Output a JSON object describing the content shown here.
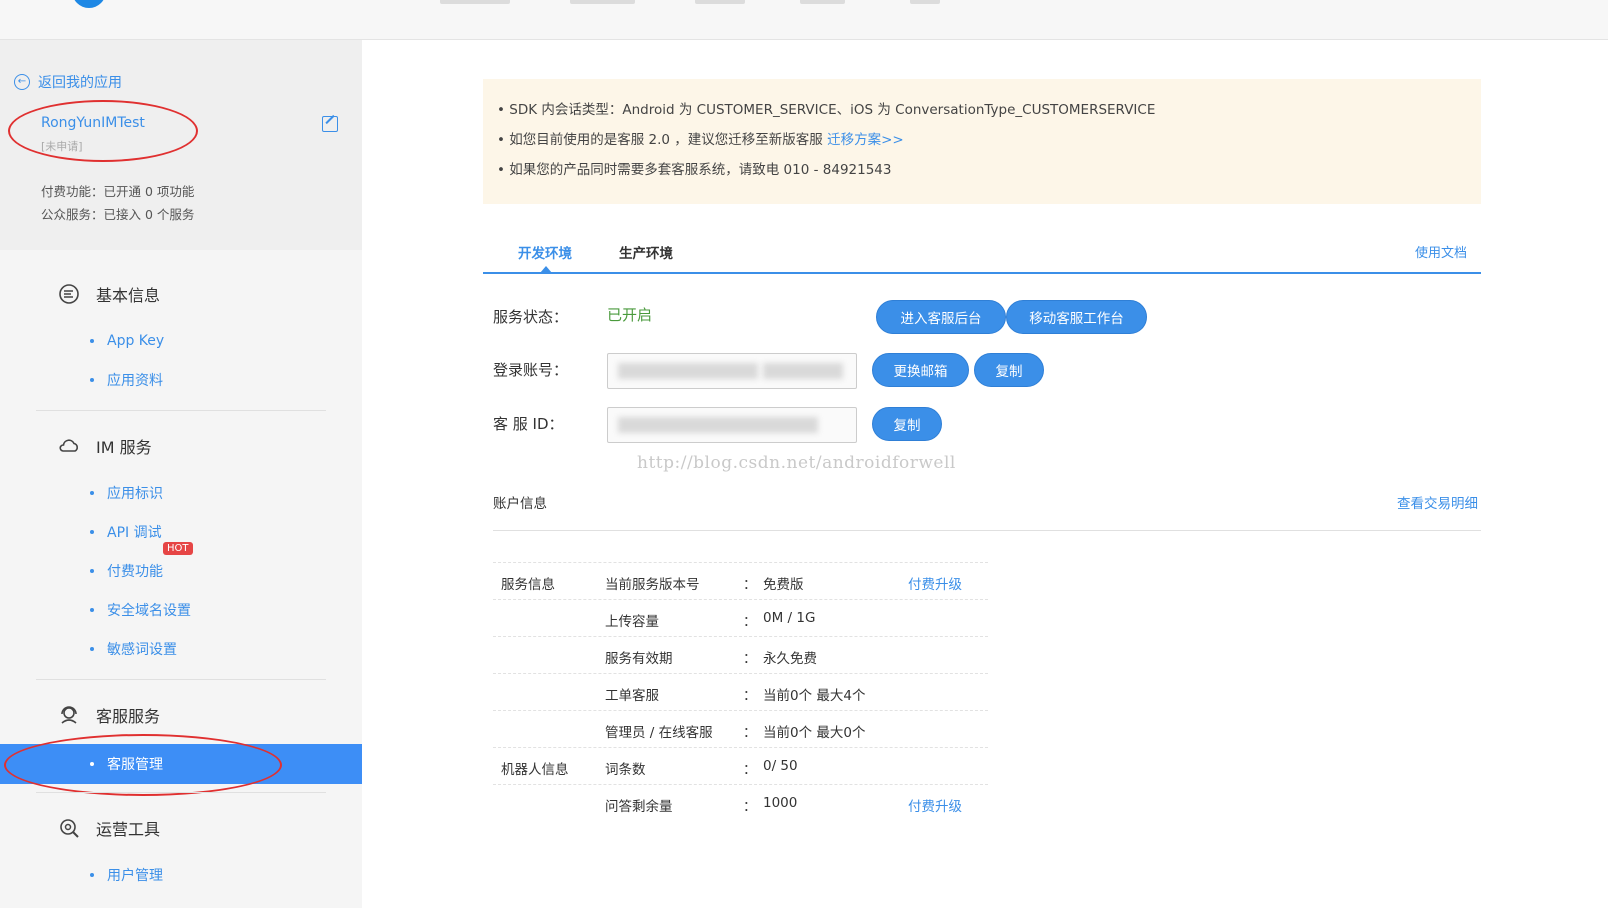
{
  "sidebar": {
    "back_label": "返回我的应用",
    "app_name": "RongYunIMTest",
    "app_status": "[未申请]",
    "paid_features": "付费功能：已开通 0 项功能",
    "public_services": "公众服务：已接入 0 个服务",
    "sections": [
      {
        "title": "基本信息",
        "icon": "list-circle-icon",
        "items": [
          "App Key",
          "应用资料"
        ]
      },
      {
        "title": "IM 服务",
        "icon": "cloud-icon",
        "items": [
          "应用标识",
          "API 调试",
          "付费功能",
          "安全域名设置",
          "敏感词设置"
        ]
      },
      {
        "title": "客服服务",
        "icon": "headset-icon",
        "items": [
          "客服管理"
        ]
      },
      {
        "title": "运营工具",
        "icon": "search-gear-icon",
        "items": [
          "用户管理"
        ]
      }
    ],
    "hot_badge": "HOT",
    "active_item": "客服管理"
  },
  "notice": {
    "line1": "• SDK 内会话类型：Android 为 CUSTOMER_SERVICE、iOS 为 ConversationType_CUSTOMERSERVICE",
    "line2_prefix": "• 如您目前使用的是客服 2.0 ，建议您迁移至新版客服 ",
    "line2_link": "迁移方案>>",
    "line3": "• 如果您的产品同时需要多套客服系统，请致电 010 - 84921543"
  },
  "tabs": {
    "dev": "开发环境",
    "prod": "生产环境",
    "docs_link": "使用文档"
  },
  "service": {
    "status_label": "服务状态：",
    "status_value": "已开启",
    "enter_backend": "进入客服后台",
    "mobile_workbench": "移动客服工作台",
    "login_label": "登录账号：",
    "change_email": "更换邮箱",
    "copy": "复制",
    "kf_id_label": "客 服 ID："
  },
  "watermark": "http://blog.csdn.net/androidforwell",
  "account": {
    "title": "账户信息",
    "txn_link": "查看交易明细",
    "rows": [
      {
        "group": "服务信息",
        "key": "当前服务版本号",
        "value": "免费版",
        "action": "付费升级"
      },
      {
        "group": "",
        "key": "上传容量",
        "value": "0M / 1G",
        "action": ""
      },
      {
        "group": "",
        "key": "服务有效期",
        "value": "永久免费",
        "action": ""
      },
      {
        "group": "",
        "key": "工单客服",
        "value": "当前0个 最大4个",
        "action": ""
      },
      {
        "group": "",
        "key": "管理员 / 在线客服",
        "value": "当前0个 最大0个",
        "action": ""
      },
      {
        "group": "机器人信息",
        "key": "词条数",
        "value": "0/ 50",
        "action": ""
      },
      {
        "group": "",
        "key": "问答剩余量",
        "value": "1000",
        "action": "付费升级"
      }
    ],
    "colon": "："
  },
  "colors": {
    "accent": "#3b8fe8",
    "active_bg": "#3d8ef6",
    "status_green": "#4a9a3c",
    "notice_bg": "#fdf6e8",
    "annotation_red": "#e03030"
  }
}
